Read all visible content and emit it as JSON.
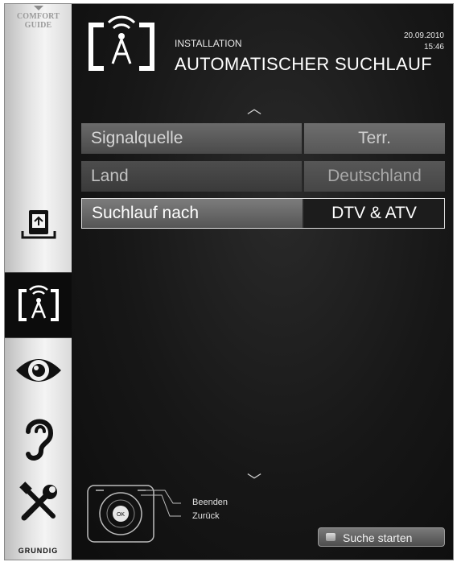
{
  "sidebar": {
    "comfort_line1": "COMFORT",
    "comfort_line2": "GUIDE",
    "brand": "GRUNDIG",
    "items": [
      {
        "icon": "media-source-icon"
      },
      {
        "icon": "installation-antenna-icon",
        "active": true
      },
      {
        "icon": "eye-picture-icon"
      },
      {
        "icon": "ear-sound-icon"
      },
      {
        "icon": "tools-settings-icon"
      }
    ]
  },
  "header": {
    "subtitle": "INSTALLATION",
    "title": "AUTOMATISCHER SUCHLAUF",
    "date": "20.09.2010",
    "time": "15:46"
  },
  "settings": {
    "rows": [
      {
        "label": "Signalquelle",
        "value": "Terr."
      },
      {
        "label": "Land",
        "value": "Deutschland"
      },
      {
        "label": "Suchlauf nach",
        "value": "DTV & ATV"
      }
    ]
  },
  "footer": {
    "exit_label": "Beenden",
    "back_label": "Zurück",
    "start_button": "Suche starten"
  },
  "colors": {
    "background": "#111111",
    "sidebar": "#e2e2e2",
    "row_bar": "#5a5a5a",
    "selected_value": "#1c1c1c"
  }
}
